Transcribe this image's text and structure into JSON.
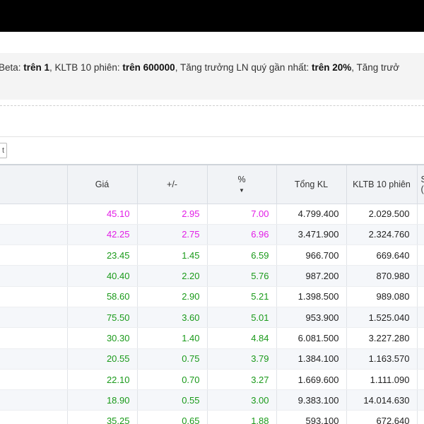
{
  "filter": {
    "parts": [
      {
        "label": "Beta: ",
        "value": "trên 1"
      },
      {
        "label": ", KLTB 10 phiên: ",
        "value": "trên 600000"
      },
      {
        "label": ", Tăng trưởng LN quý gần nhất: ",
        "value": "trên 20%"
      },
      {
        "label": ", Tăng trưở",
        "value": ""
      }
    ]
  },
  "toolbar": {
    "button_label": "t"
  },
  "table": {
    "columns": [
      {
        "key": "first",
        "label": ""
      },
      {
        "key": "gia",
        "label": "Giá"
      },
      {
        "key": "change",
        "label": "+/-"
      },
      {
        "key": "pct",
        "label": "%",
        "sort": "▼"
      },
      {
        "key": "tongkl",
        "label": "Tổng KL"
      },
      {
        "key": "kltb",
        "label": "KLTB 10 phiên"
      },
      {
        "key": "edge",
        "label": "S",
        "label2": "("
      }
    ],
    "rows": [
      {
        "gia": "45.10",
        "change": "2.95",
        "pct": "7.00",
        "tongkl": "4.799.400",
        "kltb": "2.029.500",
        "tone": "ceil"
      },
      {
        "gia": "42.25",
        "change": "2.75",
        "pct": "6.96",
        "tongkl": "3.471.900",
        "kltb": "2.324.760",
        "tone": "ceil"
      },
      {
        "gia": "23.45",
        "change": "1.45",
        "pct": "6.59",
        "tongkl": "966.700",
        "kltb": "669.640",
        "tone": "up"
      },
      {
        "gia": "40.40",
        "change": "2.20",
        "pct": "5.76",
        "tongkl": "987.200",
        "kltb": "870.980",
        "tone": "up"
      },
      {
        "gia": "58.60",
        "change": "2.90",
        "pct": "5.21",
        "tongkl": "1.398.500",
        "kltb": "989.080",
        "tone": "up"
      },
      {
        "gia": "75.50",
        "change": "3.60",
        "pct": "5.01",
        "tongkl": "953.900",
        "kltb": "1.525.040",
        "tone": "up"
      },
      {
        "gia": "30.30",
        "change": "1.40",
        "pct": "4.84",
        "tongkl": "6.081.500",
        "kltb": "3.227.280",
        "tone": "up"
      },
      {
        "gia": "20.55",
        "change": "0.75",
        "pct": "3.79",
        "tongkl": "1.384.100",
        "kltb": "1.163.570",
        "tone": "up"
      },
      {
        "gia": "22.10",
        "change": "0.70",
        "pct": "3.27",
        "tongkl": "1.669.600",
        "kltb": "1.111.090",
        "tone": "up"
      },
      {
        "gia": "18.90",
        "change": "0.55",
        "pct": "3.00",
        "tongkl": "9.383.100",
        "kltb": "14.014.630",
        "tone": "up"
      },
      {
        "gia": "35.25",
        "change": "0.65",
        "pct": "1.88",
        "tongkl": "593.100",
        "kltb": "672.640",
        "tone": "up"
      }
    ]
  },
  "colors": {
    "ceiling": "#e21de6",
    "up": "#1a9a1a"
  }
}
